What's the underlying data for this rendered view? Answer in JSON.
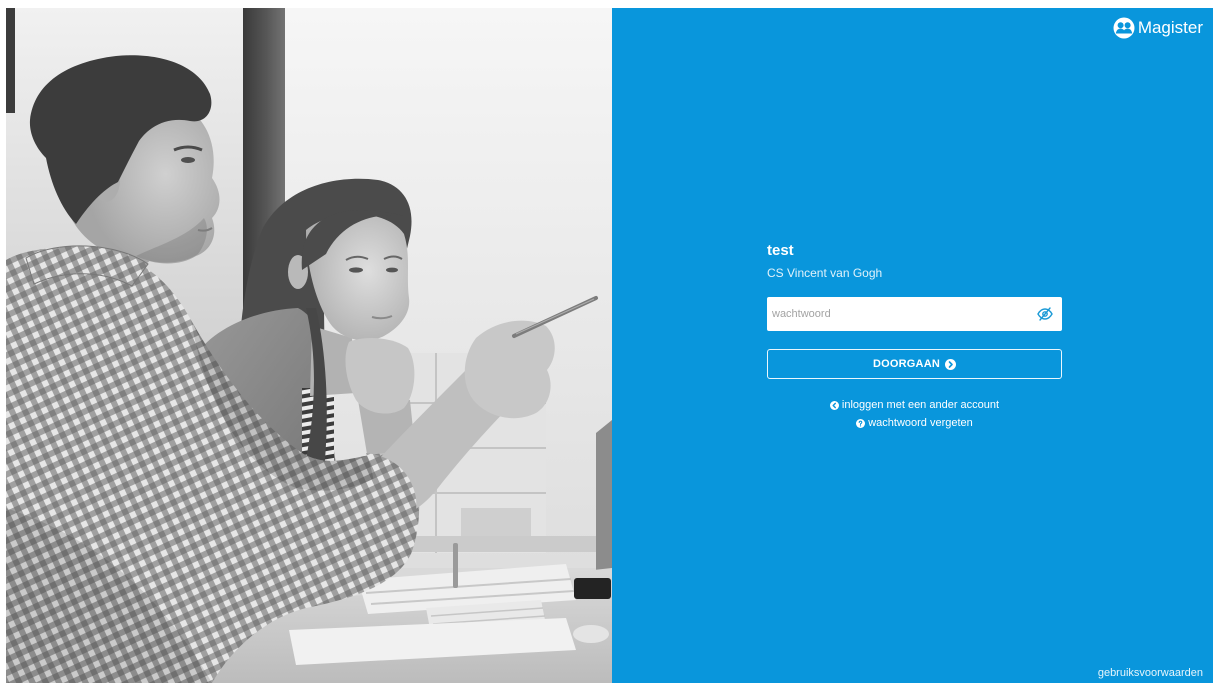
{
  "brand": {
    "name": "Magister",
    "icon": "magister-people-icon"
  },
  "login": {
    "username": "test",
    "school": "CS Vincent van Gogh",
    "password": {
      "placeholder": "wachtwoord",
      "value": "",
      "toggle_icon": "eye-slash-icon"
    },
    "submit": {
      "label": "DOORGAAN",
      "icon": "circle-chevron-right-icon"
    },
    "links": [
      {
        "label": "inloggen met een ander account",
        "icon": "circle-chevron-left-icon"
      },
      {
        "label": "wachtwoord vergeten",
        "icon": "circle-question-icon"
      }
    ]
  },
  "footer": {
    "terms_label": "gebruiksvoorwaarden"
  },
  "colors": {
    "panel_blue": "#0996dc",
    "text": "#ffffff",
    "input_background": "#ffffff",
    "placeholder": "#a3a3a3",
    "icon_blue": "#1b9ad6"
  }
}
